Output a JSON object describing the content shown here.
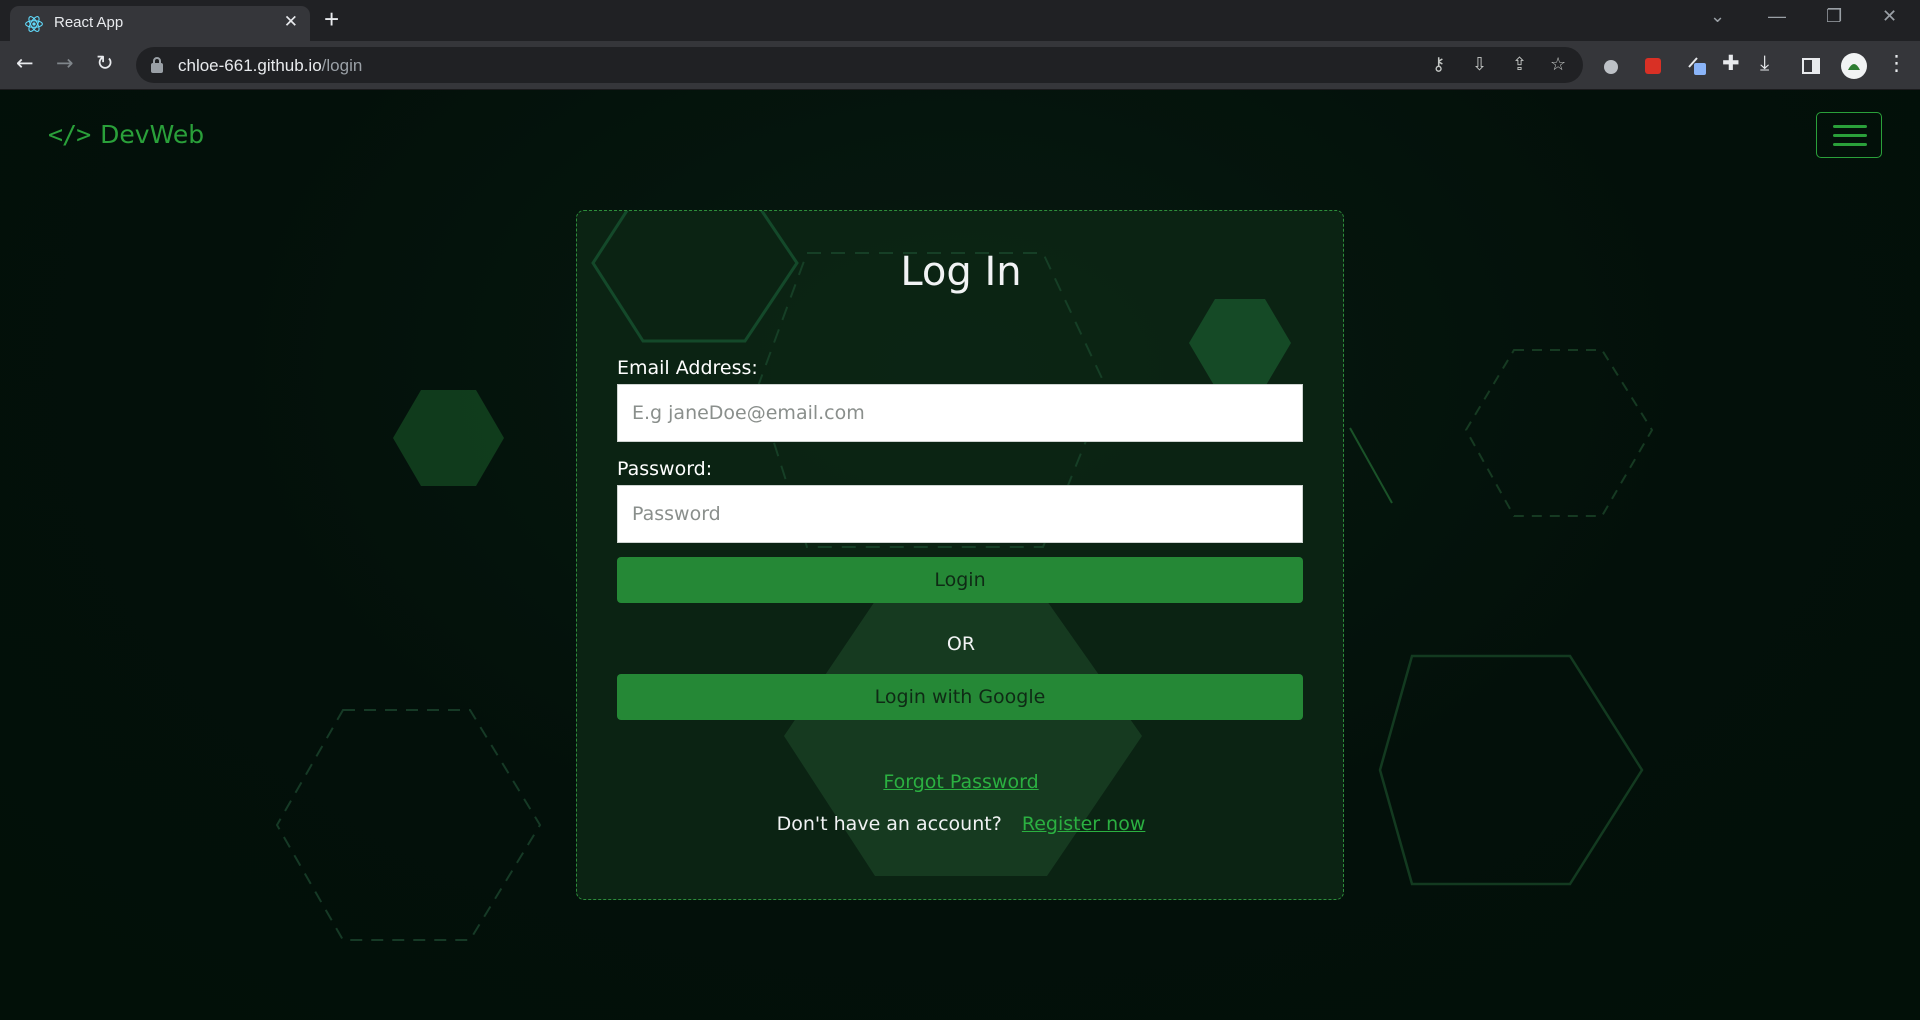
{
  "browser": {
    "tab_title": "React App",
    "tab_favicon": "react-logo-icon",
    "url_host": "chloe-661.github.io",
    "url_path": "/login"
  },
  "navbar": {
    "brand_icon_text": "</>",
    "brand_name": "DevWeb",
    "menu_icon": "hamburger-menu-icon"
  },
  "login": {
    "title": "Log In",
    "email_label": "Email Address:",
    "email_placeholder": "E.g janeDoe@email.com",
    "password_label": "Password:",
    "password_placeholder": "Password",
    "login_button": "Login",
    "or_text": "OR",
    "google_button": "Login with Google",
    "forgot_link": "Forgot Password",
    "no_account_text": "Don't have an account?",
    "register_link": "Register now"
  },
  "colors": {
    "accent": "#258836",
    "link": "#2bb041",
    "background": "#03100a"
  }
}
